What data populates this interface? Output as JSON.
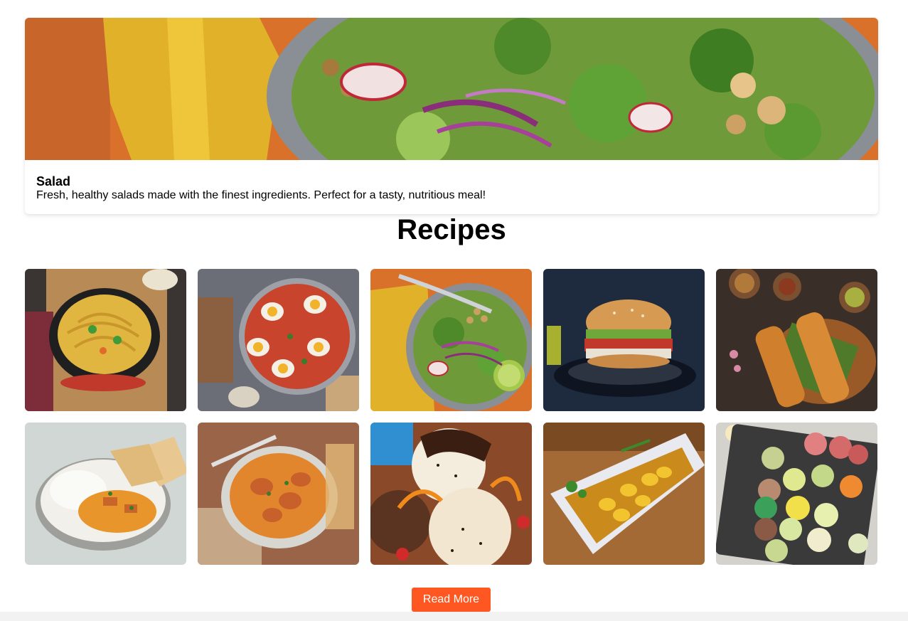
{
  "hero": {
    "title": "Salad",
    "description": "Fresh, healthy salads made with the finest ingredients. Perfect for a tasty, nutritious meal!"
  },
  "recipes_section": {
    "title": "Recipes",
    "items": [
      {
        "image": "noodles-bowl-photo"
      },
      {
        "image": "egg-curry-pan-photo"
      },
      {
        "image": "salad-bowl-photo"
      },
      {
        "image": "burger-photo"
      },
      {
        "image": "dosa-photo"
      },
      {
        "image": "butter-chicken-rice-naan-photo"
      },
      {
        "image": "chicken-curry-bowl-photo"
      },
      {
        "image": "ice-cream-scoops-photo"
      },
      {
        "image": "potato-curry-dish-photo"
      },
      {
        "image": "sweets-tray-photo"
      }
    ]
  },
  "read_more_label": "Read More",
  "colors": {
    "accent": "#ff5722",
    "footer": "#f2f2f2"
  }
}
